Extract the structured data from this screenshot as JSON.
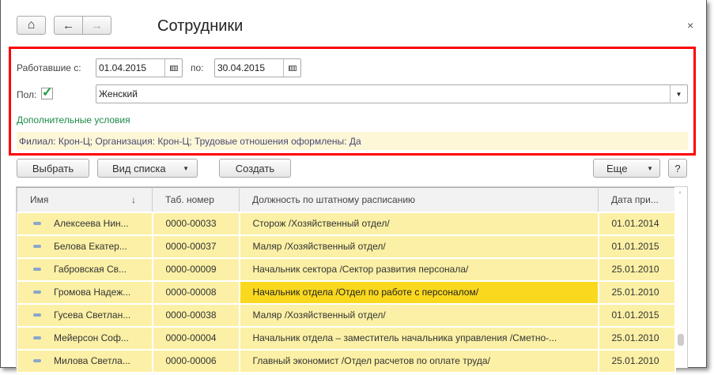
{
  "window": {
    "title": "Сотрудники",
    "close": "×"
  },
  "nav": {
    "home": "⌂",
    "back": "←",
    "forward": "→"
  },
  "filters": {
    "from_label": "Работавшие с:",
    "from_value": "01.04.2015",
    "to_label": "по:",
    "to_value": "30.04.2015",
    "gender_label": "Пол:",
    "gender_checked": "✓",
    "gender_value": "Женский",
    "extra_link": "Дополнительные условия",
    "extra_summary": "Филиал: Крон-Ц; Организация: Крон-Ц; Трудовые отношения оформлены: Да"
  },
  "toolbar": {
    "select": "Выбрать",
    "view": "Вид списка",
    "create": "Создать",
    "more": "Еще",
    "help": "?"
  },
  "table": {
    "headers": [
      "Имя",
      "Таб. номер",
      "Должность по штатному расписанию",
      "Дата при..."
    ],
    "sort_icon": "↓",
    "rows": [
      [
        "Алексеева Нин...",
        "0000-00033",
        "Сторож /Хозяйственный отдел/",
        "01.01.2014"
      ],
      [
        "Белова Екатер...",
        "0000-00037",
        "Маляр /Хозяйственный отдел/",
        "01.01.2015"
      ],
      [
        "Габровская Св...",
        "0000-00009",
        "Начальник сектора /Сектор развития персонала/",
        "25.01.2010"
      ],
      [
        "Громова Надеж...",
        "0000-00008",
        "Начальник отдела /Отдел по работе с персоналом/",
        "25.01.2010"
      ],
      [
        "Гусева Светлан...",
        "0000-00038",
        "Маляр /Хозяйственный отдел/",
        "01.01.2015"
      ],
      [
        "Мейерсон Соф...",
        "0000-00004",
        "Начальник отдела – заместитель начальника управления /Сметно-...",
        "25.01.2010"
      ],
      [
        "Милова Светла...",
        "0000-00006",
        "Главный экономист /Отдел расчетов по оплате труда/",
        "25.01.2010"
      ]
    ]
  }
}
